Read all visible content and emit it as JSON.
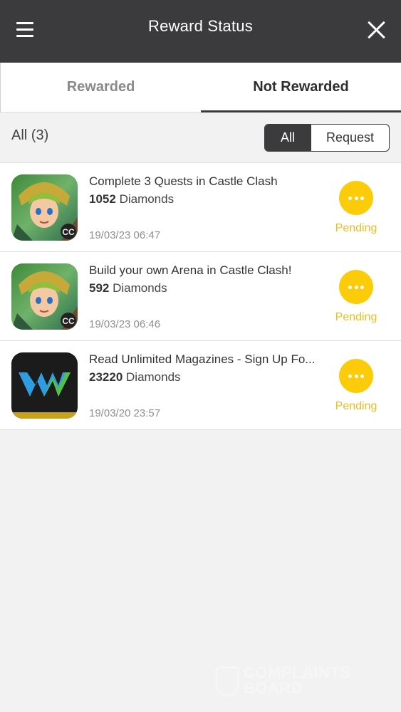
{
  "header": {
    "title": "Reward Status",
    "menu_icon": "hamburger-menu-icon",
    "close_icon": "close-icon"
  },
  "tabs": [
    {
      "label": "Rewarded",
      "active": false
    },
    {
      "label": "Not Rewarded",
      "active": true
    }
  ],
  "filter": {
    "count_label": "All (3)",
    "options": [
      {
        "label": "All",
        "active": true
      },
      {
        "label": "Request",
        "active": false
      }
    ]
  },
  "items": [
    {
      "title": "Complete 3 Quests in Castle Clash",
      "amount": "1052",
      "unit": "Diamonds",
      "date": "19/03/23 06:47",
      "status": "Pending",
      "icon": "castle-clash-app-icon"
    },
    {
      "title": "Build your own Arena in Castle Clash!",
      "amount": "592",
      "unit": "Diamonds",
      "date": "19/03/23 06:46",
      "status": "Pending",
      "icon": "castle-clash-app-icon"
    },
    {
      "title": "Read Unlimited Magazines - Sign Up Fo...",
      "amount": "23220",
      "unit": "Diamonds",
      "date": "19/03/20 23:57",
      "status": "Pending",
      "icon": "magazine-app-icon"
    }
  ],
  "watermark": {
    "line1": "COMPLAINTS",
    "line2": "BOARD"
  },
  "colors": {
    "header_bg": "#3b3b3d",
    "pending": "#fccc0a",
    "pending_text": "#f0bb1c",
    "page_bg": "#f2f2f2"
  }
}
